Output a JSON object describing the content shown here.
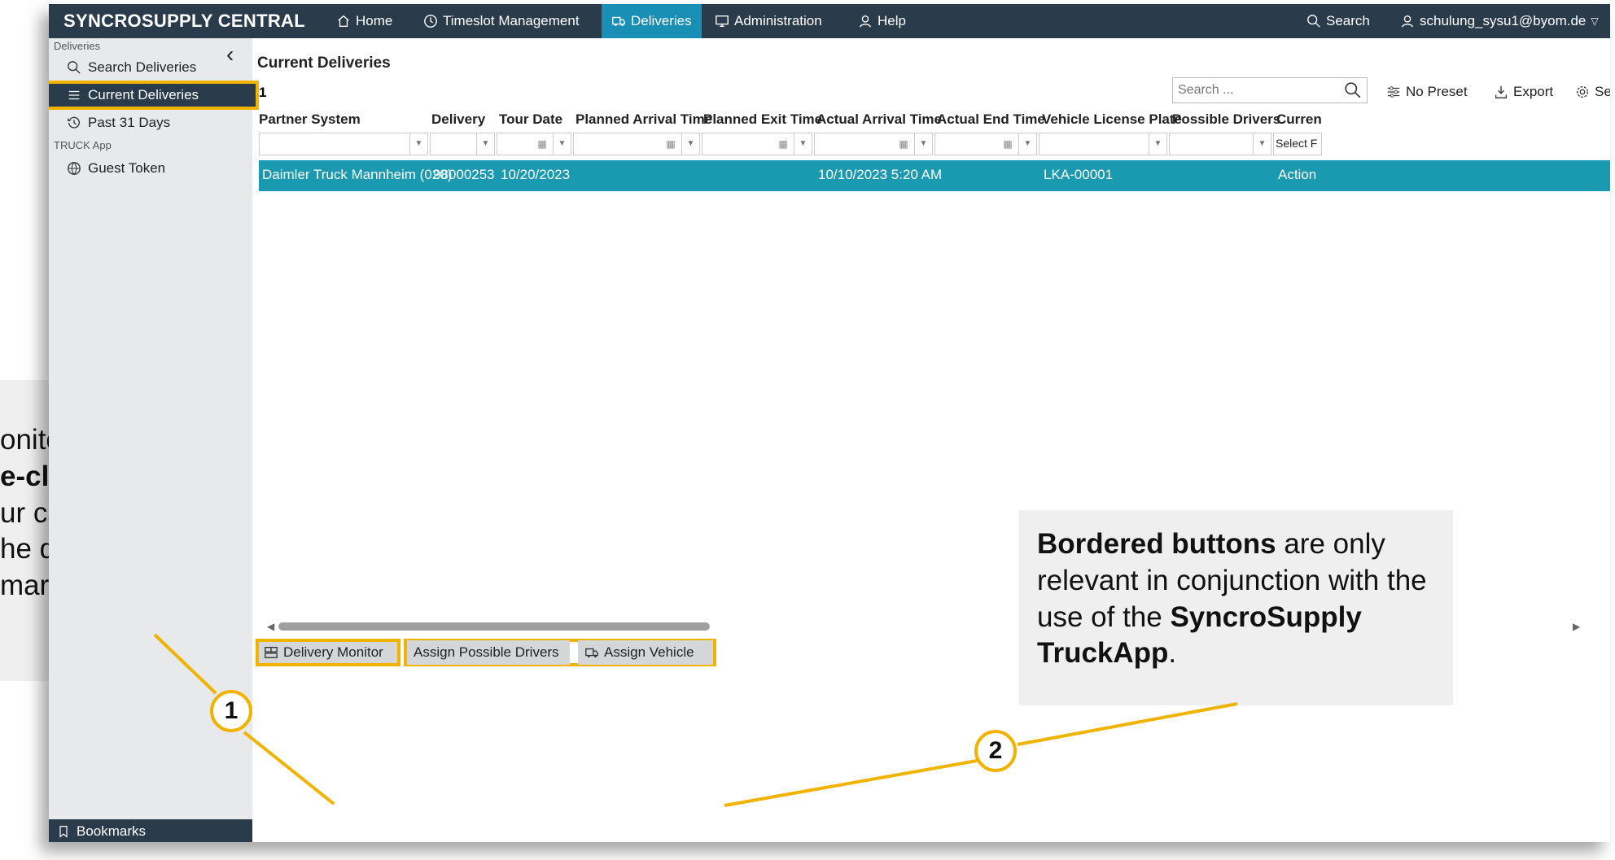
{
  "app": {
    "brand": "SYNCROSUPPLY CENTRAL",
    "nav": [
      {
        "label": "Home",
        "icon": "home-icon"
      },
      {
        "label": "Timeslot Management",
        "icon": "clock-icon"
      },
      {
        "label": "Deliveries",
        "icon": "truck-icon",
        "active": true
      },
      {
        "label": "Administration",
        "icon": "monitor-icon"
      },
      {
        "label": "Help",
        "icon": "help-icon"
      }
    ],
    "search_label": "Search",
    "user": "schulung_sysu1@byom.de"
  },
  "sidebar": {
    "section_deliveries": "Deliveries",
    "items": [
      {
        "label": "Search Deliveries",
        "icon": "search-icon"
      },
      {
        "label": "Current Deliveries",
        "icon": "list-icon",
        "active": true
      },
      {
        "label": "Past 31 Days",
        "icon": "history-icon"
      }
    ],
    "section_truck": "TRUCK App",
    "truck_items": [
      {
        "label": "Guest Token",
        "icon": "globe-icon"
      }
    ],
    "bookmarks": "Bookmarks"
  },
  "main": {
    "title": "Current Deliveries",
    "count": "1",
    "search_placeholder": "Search ...",
    "tools": {
      "preset": "No Preset",
      "export": "Export",
      "settings": "Settings"
    },
    "columns": [
      "Partner System",
      "Delivery",
      "Tour Date",
      "Planned Arrival Time",
      "Planned Exit Time",
      "Actual Arrival Time",
      "Actual End Time",
      "Vehicle License Plate",
      "Possible Drivers",
      "Curren"
    ],
    "filter_last": "Select F",
    "rows": [
      {
        "partner_system": "Daimler Truck Mannheim (020)",
        "delivery": "98000253",
        "tour_date": "10/20/2023",
        "planned_arrival": "",
        "planned_exit": "",
        "actual_arrival": "10/10/2023 5:20 AM",
        "actual_end": "",
        "plate": "LKA-00001",
        "drivers": "",
        "current": "Action"
      }
    ],
    "buttons": {
      "delivery_monitor": "Delivery Monitor",
      "assign_drivers": "Assign Possible Drivers",
      "assign_vehicle": "Assign Vehicle"
    }
  },
  "callouts": {
    "left_line1": "onitor\"",
    "left_line2_bold": "e-clicking",
    "left_line3": "ur can be",
    "left_line4": "he delivery",
    "left_line5": "marked tour",
    "right_bold1": "Bordered buttons",
    "right_text1": " are only relevant in conjunction with the use of the ",
    "right_bold2": "SyncroSupply TruckApp",
    "right_text2": ".",
    "marker1": "1",
    "marker2": "2"
  },
  "colors": {
    "topbar": "#2a3b4c",
    "accent": "#1a8fb5",
    "selected_row": "#1a9ab0",
    "highlight": "#f0b400",
    "sidebar": "#e8e9ea"
  }
}
